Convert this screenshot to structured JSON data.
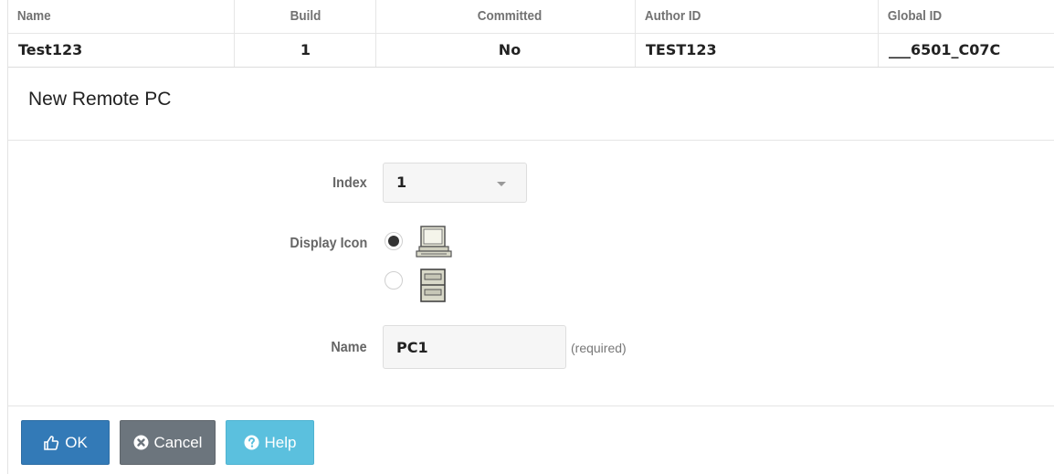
{
  "info_table": {
    "headers": [
      "Name",
      "Build",
      "Committed",
      "Author ID",
      "Global ID"
    ],
    "values": [
      "Test123",
      "1",
      "No",
      "TEST123",
      "___6501_C07C"
    ]
  },
  "panel": {
    "title": "New Remote PC"
  },
  "form": {
    "index": {
      "label": "Index",
      "selected": "1"
    },
    "display_icon": {
      "label": "Display Icon",
      "options": [
        {
          "icon": "desktop-computer-icon",
          "checked": true
        },
        {
          "icon": "file-cabinet-icon",
          "checked": false
        }
      ]
    },
    "name": {
      "label": "Name",
      "value": "PC1",
      "hint": "(required)"
    }
  },
  "buttons": {
    "ok": "OK",
    "cancel": "Cancel",
    "help": "Help"
  },
  "colors": {
    "ok": "#337ab7",
    "cancel": "#6c757d",
    "help": "#5bc0de"
  }
}
